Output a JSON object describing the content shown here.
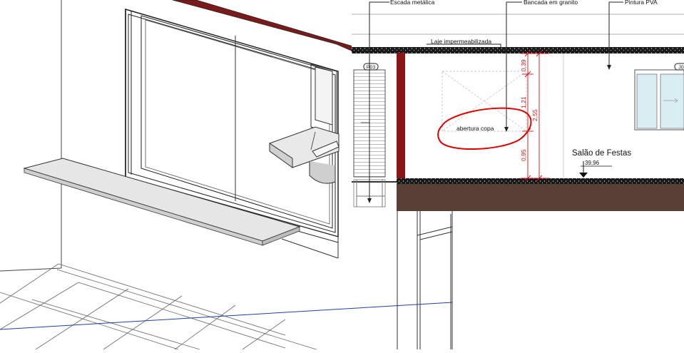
{
  "labels": {
    "escada": "Escada metálica",
    "bancada": "Bancada em granito",
    "pintura": "Pintura PVA",
    "laje": "Laje impermeabilizada",
    "abertura": "abertura copa",
    "salao": "Salão de Festas",
    "level": "39,96",
    "tag_left": "P03",
    "tag_right": "J0"
  },
  "dimensions": {
    "top": "0,39",
    "mid": "1,21",
    "bottom": "0,95",
    "total": "2,55"
  },
  "colors": {
    "wall_red": "#8b1414",
    "annotation_red": "#e00000",
    "floor_brown": "#5a3f36",
    "slab_black": "#1a1a1a",
    "glass": "#d8eef2",
    "blue_line": "#1f3f9f"
  }
}
